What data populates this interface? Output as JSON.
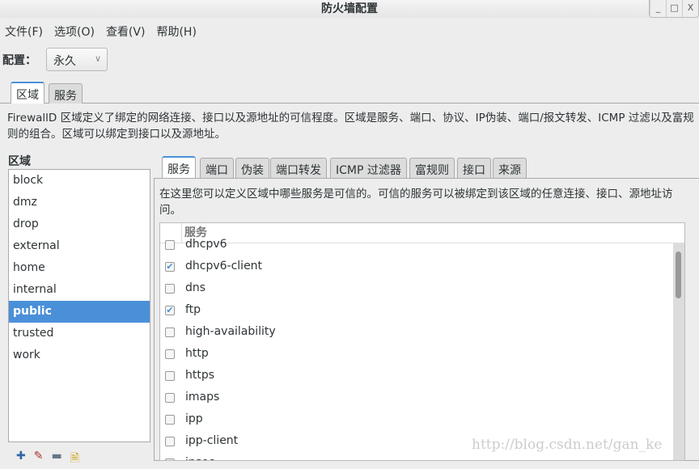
{
  "window": {
    "title": "防火墙配置",
    "controls": [
      "_",
      "□",
      "X"
    ]
  },
  "menu": [
    "文件(F)",
    "选项(O)",
    "查看(V)",
    "帮助(H)"
  ],
  "config": {
    "label": "配置：",
    "value": "永久"
  },
  "main_tabs": [
    "区域",
    "服务"
  ],
  "zone_description": "FirewallD 区域定义了绑定的网络连接、接口以及源地址的可信程度。区域是服务、端口、协议、IP伪装、端口/报文转发、ICMP 过滤以及富规则的组合。区域可以绑定到接口以及源地址。",
  "zones": {
    "heading": "区域",
    "items": [
      "block",
      "dmz",
      "drop",
      "external",
      "home",
      "internal",
      "public",
      "trusted",
      "work"
    ],
    "selected": "public"
  },
  "zone_tabs": [
    "服务",
    "端口",
    "伪装",
    "端口转发",
    "ICMP 过滤器",
    "富规则",
    "接口",
    "来源"
  ],
  "services_description": "在这里您可以定义区域中哪些服务是可信的。可信的服务可以被绑定到该区域的任意连接、接口、源地址访问。",
  "services": {
    "header": "服务",
    "rows": [
      {
        "name": "dhcpv6",
        "checked": false
      },
      {
        "name": "dhcpv6-client",
        "checked": true
      },
      {
        "name": "dns",
        "checked": false
      },
      {
        "name": "ftp",
        "checked": true
      },
      {
        "name": "high-availability",
        "checked": false
      },
      {
        "name": "http",
        "checked": false
      },
      {
        "name": "https",
        "checked": false
      },
      {
        "name": "imaps",
        "checked": false
      },
      {
        "name": "ipp",
        "checked": false
      },
      {
        "name": "ipp-client",
        "checked": false
      },
      {
        "name": "ipsec",
        "checked": false
      }
    ]
  },
  "watermark": "http://blog.csdn.net/gan_ke",
  "accent": "#4a90d9"
}
